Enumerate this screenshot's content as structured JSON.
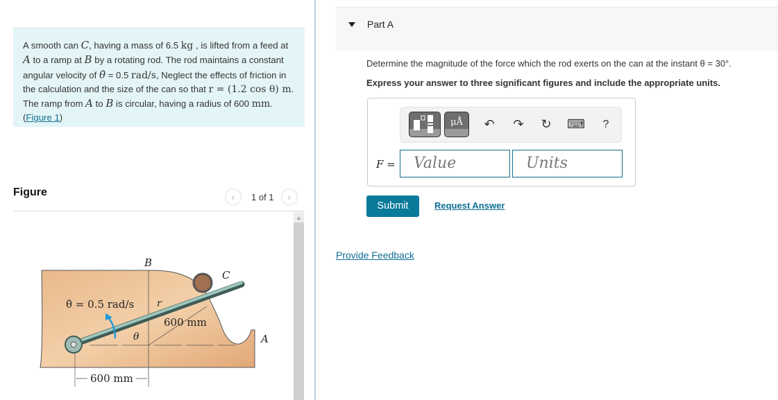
{
  "problem": {
    "text_1": "A smooth can ",
    "can_symbol": "C",
    "text_2": ", having a mass of 6.5 ",
    "mass_unit": "kg",
    "text_3": " , is lifted from a feed at ",
    "point_a": "A",
    "text_4": " to a ramp at ",
    "point_b": "B",
    "text_5": " by a rotating rod. The rod maintains a constant angular velocity of ",
    "theta_dot": "θ̇",
    "text_6": " = 0.5 ",
    "omega_unit": "rad/s",
    "text_7": ", Neglect the effects of friction in the calculation and the size of the can so that ",
    "r_expr": "r = (1.2 cos θ) m",
    "text_8": ". The ramp from ",
    "point_a2": "A",
    "text_9": " to ",
    "point_b2": "B",
    "text_10": " is circular, having a radius of 600 ",
    "radius_unit": "mm",
    "text_11": ". (",
    "figure_link": "Figure 1",
    "text_12": ")"
  },
  "figure": {
    "title": "Figure",
    "pager_text": "1 of 1",
    "prev_icon": "‹",
    "next_icon": "›",
    "labels": {
      "b": "B",
      "c": "C",
      "a": "A",
      "omega": "θ̇ = 0.5 rad/s",
      "r": "r",
      "theta": "θ",
      "radius": "600 mm",
      "base": "600 mm"
    }
  },
  "part": {
    "label": "Part A",
    "question": "Determine the magnitude of the force which the rod exerts on the can at the instant θ = 30°.",
    "instruction": "Express your answer to three significant figures and include the appropriate units."
  },
  "answer": {
    "variable_label": "F =",
    "value_placeholder": "Value",
    "units_placeholder": "Units",
    "toolbar": {
      "templates_icon": "templates-icon",
      "units_button": "μÅ",
      "undo": "↶",
      "redo": "↷",
      "reset": "↻",
      "keyboard": "⌨",
      "help": "?"
    }
  },
  "actions": {
    "submit": "Submit",
    "request_answer": "Request Answer",
    "provide_feedback": "Provide Feedback"
  }
}
